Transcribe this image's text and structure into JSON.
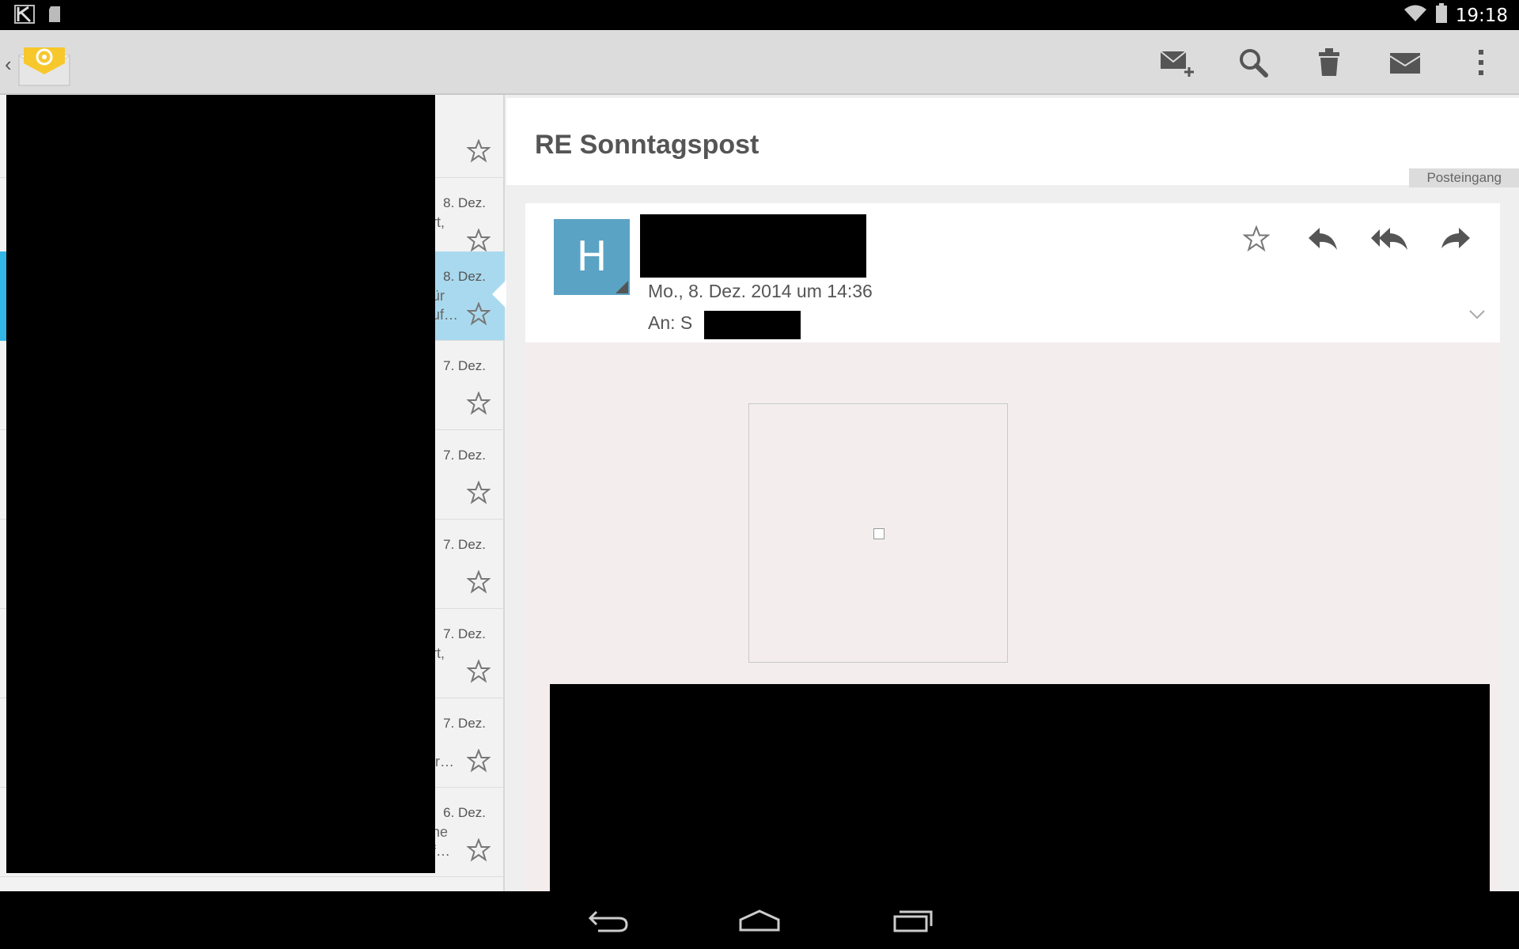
{
  "status_bar": {
    "time": "19:18",
    "icons": [
      "k9-notification-icon",
      "sd-card-icon",
      "wifi-icon",
      "battery-icon"
    ]
  },
  "action_bar": {
    "back_glyph": "‹",
    "app_icon": "email-app-icon",
    "actions": [
      "compose-icon",
      "search-icon",
      "delete-icon",
      "mark-unread-icon",
      "overflow-menu-icon"
    ]
  },
  "message_list": {
    "items": [
      {
        "date": "",
        "snippet_1": "",
        "snippet_2": "",
        "selected": false
      },
      {
        "date": "8. Dez.",
        "snippet_1": "rt,",
        "snippet_2": "",
        "selected": false
      },
      {
        "date": "8. Dez.",
        "snippet_1": "ür",
        "snippet_2": "uf…",
        "selected": true
      },
      {
        "date": "7. Dez.",
        "snippet_1": "",
        "snippet_2": "",
        "selected": false
      },
      {
        "date": "7. Dez.",
        "snippet_1": "",
        "snippet_2": "",
        "selected": false
      },
      {
        "date": "7. Dez.",
        "snippet_1": "",
        "snippet_2": "",
        "selected": false
      },
      {
        "date": "7. Dez.",
        "snippet_1": "rt,",
        "snippet_2": "",
        "selected": false
      },
      {
        "date": "7. Dez.",
        "snippet_1": "",
        "snippet_2": "ir…",
        "selected": false
      },
      {
        "date": "6. Dez.",
        "snippet_1": "ne",
        "snippet_2": "f…",
        "selected": false
      }
    ]
  },
  "message": {
    "subject": "RE Sonntagspost",
    "folder": "Posteingang",
    "avatar_letter": "H",
    "date_line": "Mo., 8. Dez. 2014 um 14:36",
    "to_label": "An: S",
    "header_actions": [
      "star-icon",
      "reply-icon",
      "reply-all-icon",
      "forward-icon"
    ]
  },
  "colors": {
    "accent": "#33b5e5",
    "selected_row": "#a9d9ee",
    "avatar": "#5ba3c4",
    "action_bar": "#dcdcdc"
  },
  "nav_bar": {
    "buttons": [
      "back-nav-icon",
      "home-nav-icon",
      "recents-nav-icon"
    ]
  }
}
